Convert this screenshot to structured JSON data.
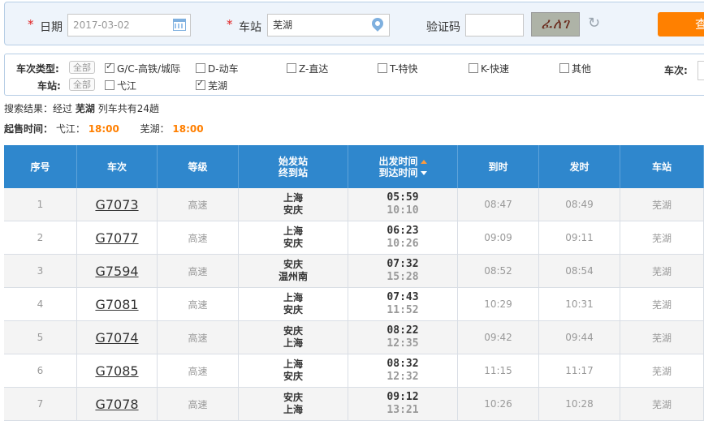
{
  "query": {
    "date_label": "日期",
    "date_value": "2017-03-02",
    "station_label": "车站",
    "station_value": "芜湖",
    "captcha_label": "验证码",
    "captcha_value": "",
    "captcha_text": "ፈለገ",
    "query_button": "查",
    "required_mark": "*"
  },
  "filters": {
    "type_label": "车次类型:",
    "all_label": "全部",
    "train_types": [
      {
        "label": "G/C-高铁/城际",
        "checked": true
      },
      {
        "label": "D-动车",
        "checked": false
      },
      {
        "label": "Z-直达",
        "checked": false
      },
      {
        "label": "T-特快",
        "checked": false
      },
      {
        "label": "K-快速",
        "checked": false
      },
      {
        "label": "其他",
        "checked": false
      }
    ],
    "trainno_label": "车次:",
    "station_label": "车站:",
    "stations": [
      {
        "label": "弋江",
        "checked": false
      },
      {
        "label": "芜湖",
        "checked": true
      }
    ]
  },
  "summary": {
    "prefix": "搜索结果：经过",
    "station": "芜湖",
    "suffix": "列车共有24趟"
  },
  "sale": {
    "label": "起售时间：",
    "items": [
      {
        "station": "弋江：",
        "time": "18:00"
      },
      {
        "station": "芜湖：",
        "time": "18:00"
      }
    ]
  },
  "table": {
    "headers": {
      "seq": "序号",
      "train": "车次",
      "grade": "等级",
      "from_line1": "始发站",
      "from_line2": "终到站",
      "time_line1": "出发时间",
      "time_line2": "到达时间",
      "arrive": "到时",
      "depart": "发时",
      "station": "车站"
    },
    "rows": [
      {
        "seq": "1",
        "train": "G7073",
        "grade": "高速",
        "from": "上海",
        "to": "安庆",
        "dep": "05:59",
        "arr": "10:10",
        "arrive": "08:47",
        "depart": "08:49",
        "station": "芜湖"
      },
      {
        "seq": "2",
        "train": "G7077",
        "grade": "高速",
        "from": "上海",
        "to": "安庆",
        "dep": "06:23",
        "arr": "10:26",
        "arrive": "09:09",
        "depart": "09:11",
        "station": "芜湖"
      },
      {
        "seq": "3",
        "train": "G7594",
        "grade": "高速",
        "from": "安庆",
        "to": "温州南",
        "dep": "07:32",
        "arr": "15:28",
        "arrive": "08:52",
        "depart": "08:54",
        "station": "芜湖"
      },
      {
        "seq": "4",
        "train": "G7081",
        "grade": "高速",
        "from": "上海",
        "to": "安庆",
        "dep": "07:43",
        "arr": "11:52",
        "arrive": "10:29",
        "depart": "10:31",
        "station": "芜湖"
      },
      {
        "seq": "5",
        "train": "G7074",
        "grade": "高速",
        "from": "安庆",
        "to": "上海",
        "dep": "08:22",
        "arr": "12:35",
        "arrive": "09:42",
        "depart": "09:44",
        "station": "芜湖"
      },
      {
        "seq": "6",
        "train": "G7085",
        "grade": "高速",
        "from": "上海",
        "to": "安庆",
        "dep": "08:32",
        "arr": "12:32",
        "arrive": "11:15",
        "depart": "11:17",
        "station": "芜湖"
      },
      {
        "seq": "7",
        "train": "G7078",
        "grade": "高速",
        "from": "安庆",
        "to": "上海",
        "dep": "09:12",
        "arr": "13:21",
        "arrive": "10:26",
        "depart": "10:28",
        "station": "芜湖"
      }
    ]
  }
}
